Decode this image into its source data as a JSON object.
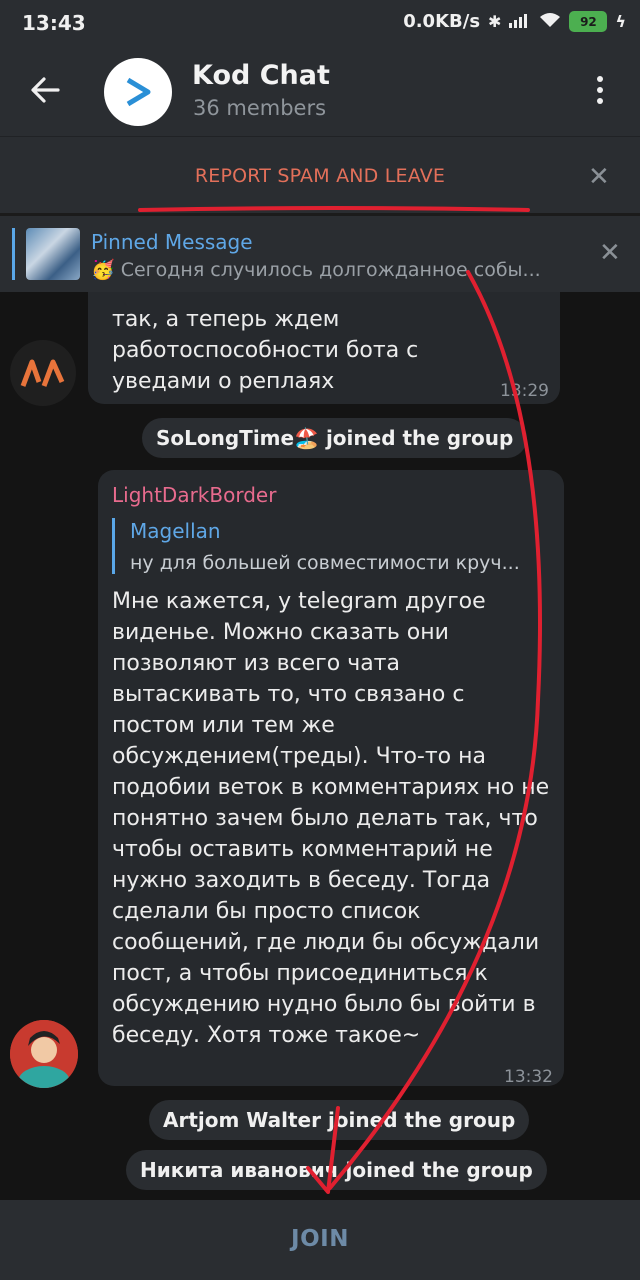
{
  "status_bar": {
    "time": "13:43",
    "net_speed": "0.0KB/s",
    "battery_level": "92",
    "icons": [
      "bluetooth-icon",
      "signal-icon",
      "wifi-icon",
      "battery-icon",
      "charging-icon"
    ]
  },
  "header": {
    "title": "Kod Chat",
    "subtitle": "36 members",
    "icons": [
      "back-arrow-icon",
      "more-vertical-icon"
    ]
  },
  "report_bar": {
    "label": "REPORT SPAM AND LEAVE"
  },
  "pinned": {
    "title": "Pinned Message",
    "text": "🥳 Сегодня случилось долгожданное собы..."
  },
  "messages": [
    {
      "text": "так, а теперь ждем работоспособности бота с уведами о реплаях",
      "time": "13:29"
    },
    {
      "sender": "LightDarkBorder",
      "reply_name": "Magellan",
      "reply_text": "ну для большей совместимости круч...",
      "text": "Мне кажется, у  telegram другое виденье. Можно сказать они позволяют из всего чата вытаскивать то, что связано с постом или тем же обсуждением(треды). Что-то на подобии веток в комментариях но не понятно зачем было делать так, что чтобы оставить комментарий не нужно заходить в беседу. Тогда сделали бы просто список сообщений, где люди бы обсуждали пост, а чтобы присоединиться к обсуждению нудно было бы войти в беседу. Хотя тоже такое~",
      "time": "13:32"
    }
  ],
  "system_messages": [
    "SoLongTime🏖️ joined the group",
    "Artjom Walter joined the group",
    "Никита иванович joined the group"
  ],
  "join_button": "JOIN",
  "colors": {
    "accent_blue": "#5fa7e6",
    "report_red": "#e3705a",
    "sender_pink": "#e86b8e",
    "join_blue": "#6d8aa6",
    "annotation_red": "#e02030"
  }
}
